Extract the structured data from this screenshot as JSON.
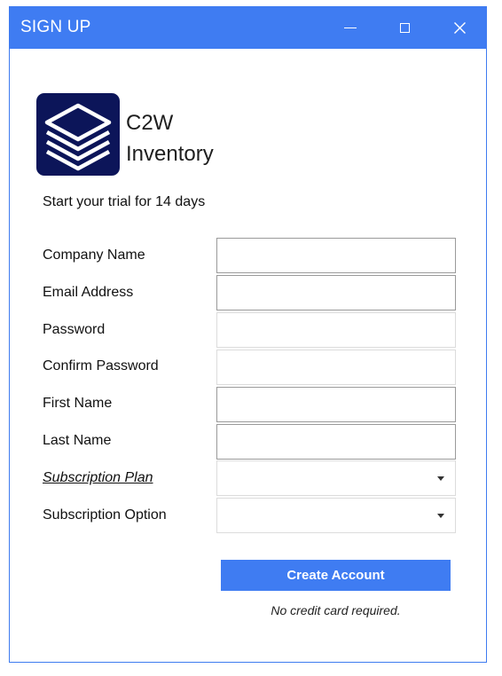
{
  "window": {
    "title": "SIGN UP",
    "controls": {
      "minimize": "minimize-icon",
      "maximize": "maximize-icon",
      "close": "close-icon"
    },
    "accent_color": "#3f7cf2"
  },
  "branding": {
    "logo_icon": "stacked-layers-icon",
    "logo_bg_color": "#0c1559",
    "name_line1": "C2W",
    "name_line2": "Inventory"
  },
  "subtitle": "Start your trial for 14 days",
  "form": {
    "company_name": {
      "label": "Company Name",
      "value": "",
      "placeholder": ""
    },
    "email": {
      "label": "Email Address",
      "value": "",
      "placeholder": ""
    },
    "password": {
      "label": "Password",
      "value": "",
      "placeholder": ""
    },
    "confirm_password": {
      "label": "Confirm Password",
      "value": "",
      "placeholder": ""
    },
    "first_name": {
      "label": "First Name",
      "value": "",
      "placeholder": ""
    },
    "last_name": {
      "label": "Last Name",
      "value": "",
      "placeholder": ""
    },
    "subscription_plan": {
      "label": "Subscription Plan",
      "value": ""
    },
    "subscription_option": {
      "label": "Subscription Option",
      "value": ""
    }
  },
  "actions": {
    "create_account": "Create Account",
    "note": "No credit card required."
  }
}
